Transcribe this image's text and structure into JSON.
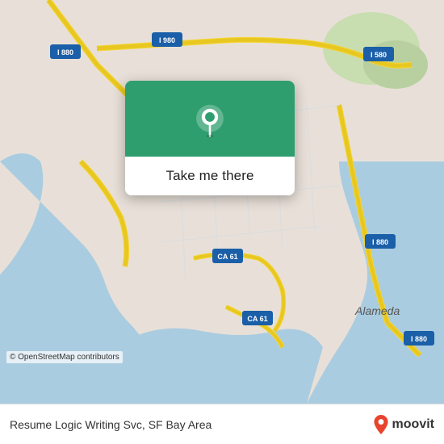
{
  "map": {
    "attribution": "© OpenStreetMap contributors"
  },
  "popup": {
    "button_label": "Take me there"
  },
  "bottom_bar": {
    "location_text": "Resume Logic Writing Svc, SF Bay Area"
  },
  "moovit": {
    "logo_text": "moovit"
  },
  "colors": {
    "map_bg": "#e8e0d8",
    "popup_header_bg": "#2e9e6e",
    "road_yellow": "#f5d63d",
    "water_blue": "#b8d4e8",
    "accent_red": "#e8432d"
  }
}
